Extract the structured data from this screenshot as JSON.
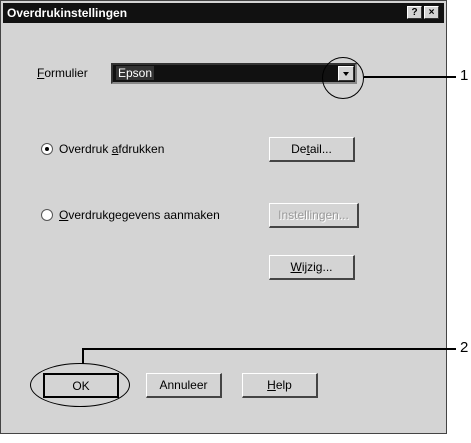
{
  "dialog": {
    "title": "Overdrukinstellingen",
    "help_button": "?",
    "close_button": "×"
  },
  "form": {
    "label_prefix": "F",
    "label_rest": "ormulier",
    "value": "Epson"
  },
  "options": [
    {
      "label_pre": "Overdruk ",
      "label_u": "a",
      "label_post": "fdrukken",
      "selected": true
    },
    {
      "label_pre": "",
      "label_u": "O",
      "label_post": "verdrukgegevens aanmaken",
      "selected": false
    }
  ],
  "buttons": {
    "details": {
      "pre": "De",
      "u": "t",
      "post": "ail..."
    },
    "settings": {
      "label": "Instellingen..."
    },
    "edit": {
      "pre": "",
      "u": "W",
      "post": "ijzig..."
    },
    "ok": {
      "label": "OK"
    },
    "cancel": {
      "label": "Annuleer"
    },
    "help": {
      "pre": "",
      "u": "H",
      "post": "elp"
    }
  },
  "callouts": [
    "1",
    "2"
  ]
}
